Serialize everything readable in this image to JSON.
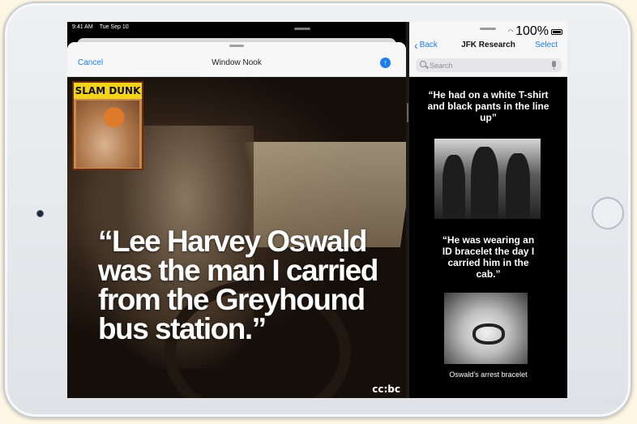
{
  "status_bar": {
    "time": "9:41 AM",
    "date": "Tue Sep 10",
    "battery": "100%",
    "wifi_icon": "wifi-icon",
    "battery_icon": "battery-icon"
  },
  "left_sheet": {
    "cancel_label": "Cancel",
    "title": "Window Nook",
    "send_icon": "arrow-up-circle-icon",
    "send_glyph": "↑",
    "poster_title": "SLAM DUNK",
    "quote": "“Lee Harvey Oswald was the man I carried from the Greyhound bus station.”",
    "watermark": "cc:bc"
  },
  "right_pane": {
    "back_label": "Back",
    "back_glyph": "‹",
    "title": "JFK Research",
    "select_label": "Select",
    "search_placeholder": "Search",
    "quote_1": "“He had on a white T-shirt and black pants in the line up”",
    "quote_2": "“He was wearing an ID bracelet the day I carried him in the cab.”",
    "caption": "Oswald’s arrest bracelet"
  },
  "frame_watermark": "cc:bc",
  "colors": {
    "accent": "#1a7df0",
    "poster_yellow": "#f3d31c",
    "note_background": "#000000"
  }
}
